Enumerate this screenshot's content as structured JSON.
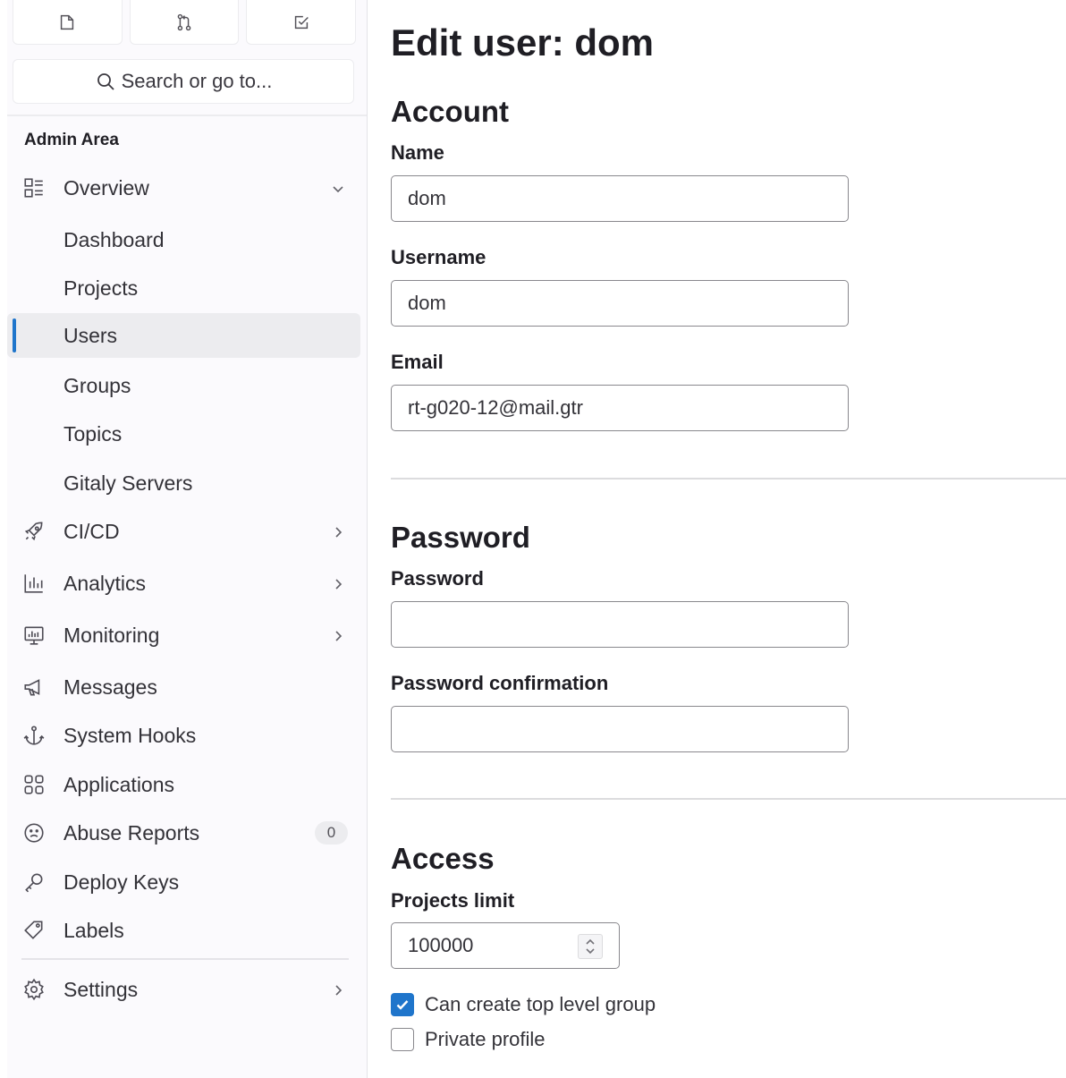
{
  "sidebar": {
    "search_placeholder": "Search or go to...",
    "section_title": "Admin Area",
    "overview_label": "Overview",
    "sub_items": [
      "Dashboard",
      "Projects",
      "Users",
      "Groups",
      "Topics",
      "Gitaly Servers"
    ],
    "cicd_label": "CI/CD",
    "analytics_label": "Analytics",
    "monitoring_label": "Monitoring",
    "messages_label": "Messages",
    "system_hooks_label": "System Hooks",
    "applications_label": "Applications",
    "abuse_reports_label": "Abuse Reports",
    "abuse_reports_count": "0",
    "deploy_keys_label": "Deploy Keys",
    "labels_label": "Labels",
    "settings_label": "Settings"
  },
  "main": {
    "title": "Edit user: dom",
    "account": {
      "heading": "Account",
      "name_label": "Name",
      "name_value": "dom",
      "username_label": "Username",
      "username_value": "dom",
      "email_label": "Email",
      "email_value": "rt-g020-12@mail.gtr"
    },
    "password": {
      "heading": "Password",
      "password_label": "Password",
      "password_value": "",
      "confirmation_label": "Password confirmation",
      "confirmation_value": ""
    },
    "access": {
      "heading": "Access",
      "projects_limit_label": "Projects limit",
      "projects_limit_value": "100000",
      "can_create_group_label": "Can create top level group",
      "can_create_group_checked": true,
      "private_profile_label": "Private profile",
      "private_profile_checked": false
    }
  },
  "colors": {
    "accent": "#1f75cb",
    "sidebar_bg": "#fbfafd",
    "active_bg": "#ececef"
  }
}
